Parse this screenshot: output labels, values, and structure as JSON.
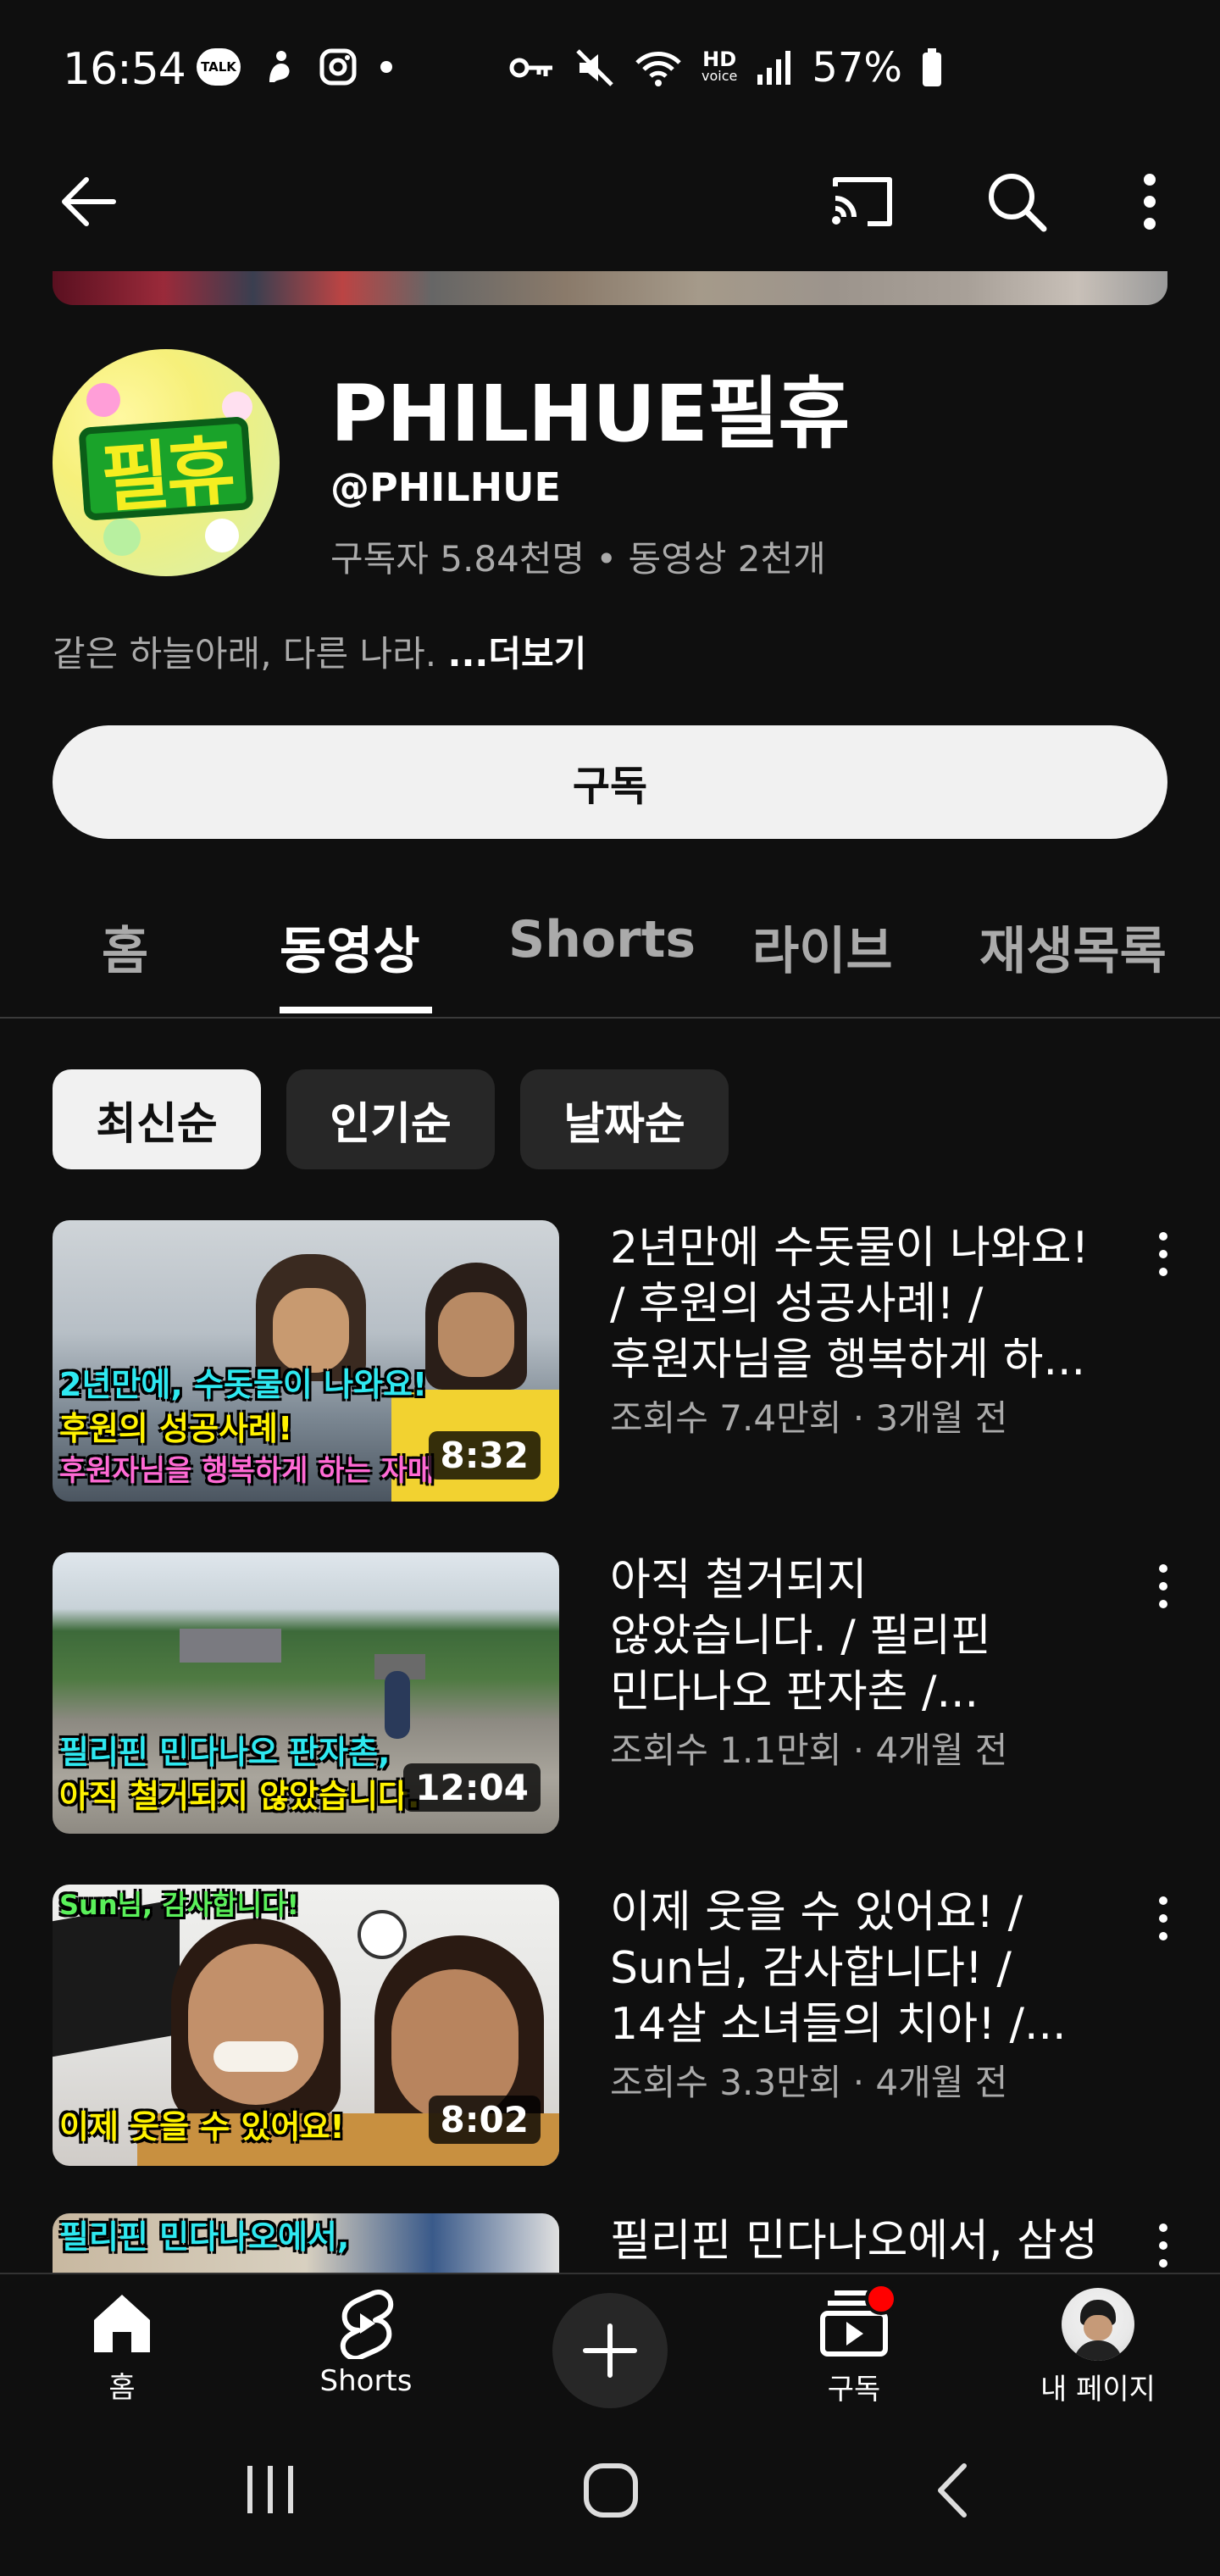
{
  "status_bar": {
    "time": "16:54",
    "talk_badge": "TALK",
    "battery_percent": "57%",
    "network_label": "HD",
    "network_sub": "voice",
    "left_icons": [
      "kakaotalk-icon",
      "bixby-icon",
      "instagram-icon",
      "dot-icon"
    ],
    "right_icons": [
      "key-icon",
      "mute-icon",
      "wifi-icon",
      "hd-voice-icon",
      "signal-icon",
      "battery-icon"
    ]
  },
  "top_bar": {
    "icons": [
      "back-arrow-icon",
      "cast-icon",
      "search-icon",
      "more-vert-icon"
    ]
  },
  "channel": {
    "name": "PHILHUE필휴",
    "handle": "@PHILHUE",
    "stats": "구독자 5.84천명 • 동영상 2천개",
    "description": "같은 하늘아래, 다른 나라.",
    "more_label": "...더보기",
    "avatar_text": "필휴",
    "subscribe_label": "구독"
  },
  "tabs": [
    {
      "label": "홈",
      "active": false
    },
    {
      "label": "동영상",
      "active": true
    },
    {
      "label": "Shorts",
      "active": false
    },
    {
      "label": "라이브",
      "active": false
    },
    {
      "label": "재생목록",
      "active": false
    }
  ],
  "sort_chips": [
    {
      "label": "최신순",
      "selected": true
    },
    {
      "label": "인기순",
      "selected": false
    },
    {
      "label": "날짜순",
      "selected": false
    }
  ],
  "videos": [
    {
      "title_lines": [
        "2년만에 수돗물이 나와요!",
        "/ 후원의 성공사례! /",
        "후원자님을 행복하게 하..."
      ],
      "meta": "조회수 7.4만회 · 3개월 전",
      "duration": "8:32",
      "overlay_lines": [
        "2년만에, 수돗물이 나와요!",
        "후원의 성공사례!",
        "후원자님을 행복하게 하는 자매"
      ]
    },
    {
      "title_lines": [
        "아직 철거되지",
        "않았습니다. / 필리핀",
        "민다나오 판자촌 /..."
      ],
      "meta": "조회수 1.1만회 · 4개월 전",
      "duration": "12:04",
      "overlay_lines": [
        "필리핀 민다나오 판자촌,",
        "아직 철거되지 않았습니다."
      ]
    },
    {
      "title_lines": [
        "이제 웃을 수 있어요! /",
        "Sun님, 감사합니다! /",
        "14살 소녀들의 치아! /..."
      ],
      "meta": "조회수 3.3만회 · 4개월 전",
      "duration": "8:02",
      "overlay_lines": [
        "Sun님, 감사합니다!",
        "이제 웃을 수 있어요!"
      ]
    },
    {
      "title_lines": [
        "필리핀 민다나오에서, 삼성"
      ],
      "meta": "",
      "duration": "",
      "overlay_lines": [
        "필리핀 민다나오에서,"
      ]
    }
  ],
  "bottom_nav": [
    {
      "label": "홈",
      "icon": "home-icon"
    },
    {
      "label": "Shorts",
      "icon": "shorts-icon"
    },
    {
      "label": "",
      "icon": "create-plus-icon"
    },
    {
      "label": "구독",
      "icon": "subscriptions-icon"
    },
    {
      "label": "내 페이지",
      "icon": "profile-avatar"
    }
  ],
  "system_nav": [
    "recents-icon",
    "home-circle-icon",
    "back-chevron-icon"
  ],
  "colors": {
    "background": "#0f0f0f",
    "secondary_text": "#aaaaaa",
    "chip_bg": "#272727",
    "subscribe_bg": "#f1f1f1",
    "notification_dot": "#ff0000",
    "overlay_cyan": "#2ee8f0",
    "overlay_yellow": "#fff200",
    "overlay_pink": "#ff6ad5"
  }
}
